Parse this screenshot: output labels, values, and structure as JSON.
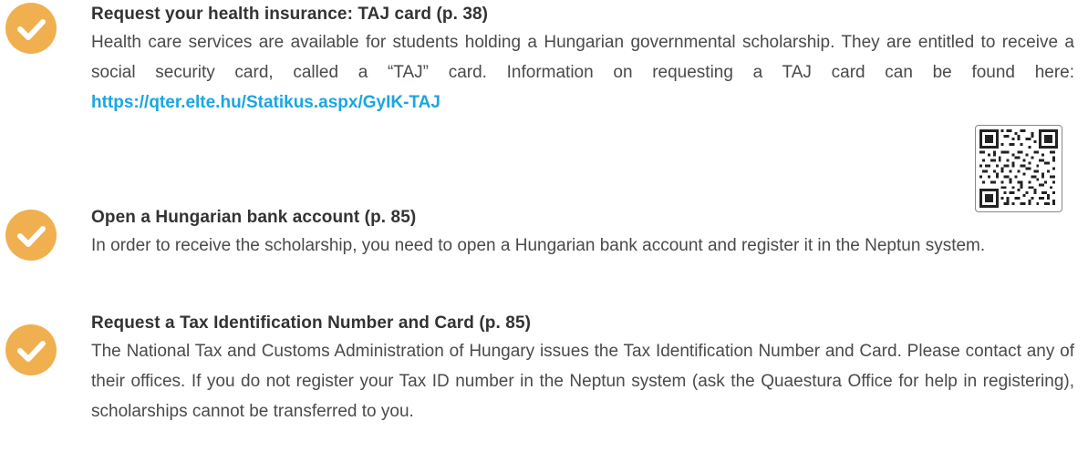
{
  "items": [
    {
      "title": "Request your health insurance: TAJ card (p. 38)",
      "body_before_link": "Health care services are available for students holding a Hungarian governmental scholarship. They are entitled to receive a social security card, called a “TAJ” card. Information on requesting a TAJ card can be found here: ",
      "link": "https://qter.elte.hu/Statikus.aspx/GyIK-TAJ",
      "icon": "check-icon"
    },
    {
      "title": "Open a Hungarian bank account (p. 85)",
      "body": "In order to receive the scholarship, you need to open a Hungarian bank account and register it in the Neptun system.",
      "icon": "check-icon"
    },
    {
      "title": "Request a Tax Identification Number and Card (p. 85)",
      "body": "The National Tax and Customs Administration of Hungary issues the Tax Identification Number and Card. Please contact any of their offices. If you do not register your Tax ID number in the Neptun system (ask the Quaestura Office for help in registering), scholarships cannot be transferred to you.",
      "icon": "check-icon"
    }
  ],
  "qr_code": {
    "icon": "qr-code-icon"
  },
  "colors": {
    "check_circle": "#f0b050",
    "link": "#1aa6e0",
    "text": "#4a4a4a",
    "title": "#333333"
  }
}
